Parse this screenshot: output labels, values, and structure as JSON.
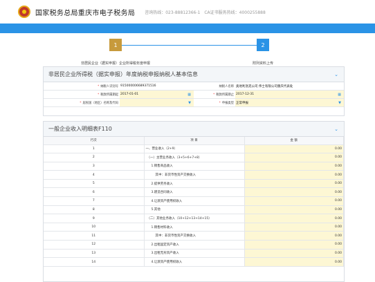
{
  "header": {
    "title": "国家税务总局重庆市电子税务局",
    "hotline": "咨询热线：023-88812366-1　CA证书服务热线：4000255888"
  },
  "steps": [
    {
      "num": "1",
      "label": "非居民企业（据实申报）企业所得税年度申报"
    },
    {
      "num": "2",
      "label": "附列资料上传"
    }
  ],
  "panel1": {
    "title": "非居民企业所得税（据实申报）年度纳税申报纳税人基本信息",
    "fields": {
      "taxpayer_id": {
        "label": "纳税人识别号",
        "value": "915000006689371516"
      },
      "taxpayer_name": {
        "label": "纳税人名称",
        "value": "奥地利洛克公司 伟士有限公司重庆代表处"
      },
      "period_start": {
        "label": "税款所属期起",
        "value": "2017-01-01"
      },
      "period_end": {
        "label": "税款所属期止",
        "value": "2017-12-31"
      },
      "country": {
        "label": "居民国（地区）名称及代码",
        "value": ""
      },
      "return_type": {
        "label": "申报类型",
        "value": "正常申报"
      }
    }
  },
  "panel2": {
    "title": "一般企业收入明细表F110",
    "columns": [
      "行次",
      "项 目",
      "金 额"
    ],
    "rows": [
      {
        "n": "1",
        "item": "一、营业收入（2+9）",
        "amt": "0.00"
      },
      {
        "n": "2",
        "item": "（一）主营业务收入（3+5+6+7+8）",
        "amt": "0.00"
      },
      {
        "n": "3",
        "item": "1.销售商品收入",
        "amt": "0.00"
      },
      {
        "n": "4",
        "item": "其中：非货币性资产交换收入",
        "amt": "0.00"
      },
      {
        "n": "5",
        "item": "2.提供劳务收入",
        "amt": "0.00"
      },
      {
        "n": "6",
        "item": "3.建造合同收入",
        "amt": "0.00"
      },
      {
        "n": "7",
        "item": "4.让渡资产使用权收入",
        "amt": "0.00"
      },
      {
        "n": "8",
        "item": "5.其他",
        "amt": "0.00"
      },
      {
        "n": "9",
        "item": "（二）其他业务收入（10+12+13+14+15）",
        "amt": "0.00"
      },
      {
        "n": "10",
        "item": "1.销售材料收入",
        "amt": "0.00"
      },
      {
        "n": "11",
        "item": "其中：非货币性资产交换收入",
        "amt": "0.00"
      },
      {
        "n": "12",
        "item": "2.出租固定资产收入",
        "amt": "0.00"
      },
      {
        "n": "13",
        "item": "3.出租无形资产收入",
        "amt": "0.00"
      },
      {
        "n": "14",
        "item": "4.让渡资产使用权收入",
        "amt": "0.00"
      }
    ]
  }
}
